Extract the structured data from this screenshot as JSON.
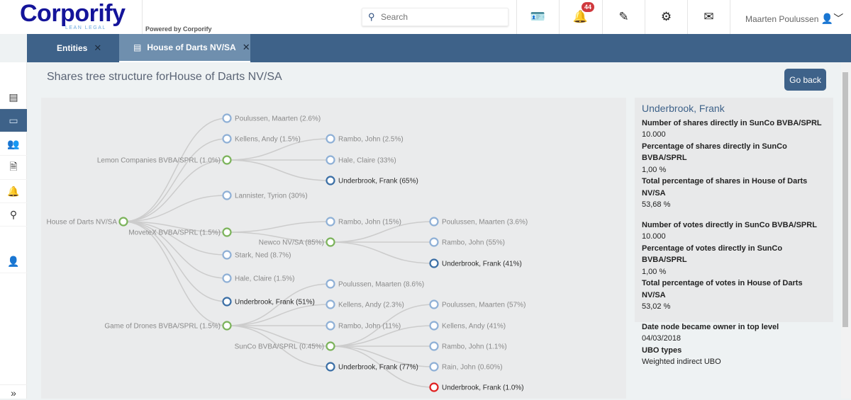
{
  "header": {
    "logo": "Corporify",
    "logo_tagline": "LEAN LEGAL",
    "powered": "Powered by Corporify",
    "search_placeholder": "Search",
    "notifications_count": "44",
    "user_name": "Maarten Poulussen"
  },
  "tabs": [
    {
      "label": "Entities",
      "close": "✕"
    },
    {
      "label": "House of Darts NV/SA",
      "close": "✕"
    }
  ],
  "sidebar": {
    "items": [
      "entities-icon",
      "id-card-icon",
      "people-icon",
      "document-icon",
      "bell-icon",
      "search-icon",
      "user-icon"
    ],
    "expand": "»"
  },
  "page": {
    "title": "Shares tree structure forHouse of Darts NV/SA",
    "go_back": "Go back"
  },
  "colors": {
    "company": "#7bb35a",
    "person": "#8fb0d6",
    "ubo": "#3a6ea5",
    "selected": "#e02020",
    "link": "#cccccc",
    "accent": "#3e6289"
  },
  "tree": {
    "label": "House of Darts NV/SA",
    "type": "company",
    "children": [
      {
        "label": "Poulussen, Maarten (2.6%)",
        "type": "person"
      },
      {
        "label": "Kellens, Andy (1.5%)",
        "type": "person"
      },
      {
        "label": "Lemon Companies BVBA/SPRL (1.0%)",
        "type": "company",
        "children": [
          {
            "label": "Rambo, John (2.5%)",
            "type": "person"
          },
          {
            "label": "Hale, Claire (33%)",
            "type": "person"
          },
          {
            "label": "Underbrook, Frank (65%)",
            "type": "ubo"
          }
        ]
      },
      {
        "label": "Lannister, Tyrion (30%)",
        "type": "person"
      },
      {
        "label": "MoveteX BVBA/SPRL (1.5%)",
        "type": "company",
        "children": [
          {
            "label": "Rambo, John (15%)",
            "type": "person"
          },
          {
            "label": "Newco NV/SA (85%)",
            "type": "company",
            "children": [
              {
                "label": "Poulussen, Maarten (3.6%)",
                "type": "person"
              },
              {
                "label": "Rambo, John (55%)",
                "type": "person"
              },
              {
                "label": "Underbrook, Frank (41%)",
                "type": "ubo"
              }
            ]
          }
        ]
      },
      {
        "label": "Stark, Ned (8.7%)",
        "type": "person"
      },
      {
        "label": "Hale, Claire (1.5%)",
        "type": "person"
      },
      {
        "label": "Underbrook, Frank (51%)",
        "type": "ubo"
      },
      {
        "label": "Game of Drones BVBA/SPRL (1.5%)",
        "type": "company",
        "children": [
          {
            "label": "Poulussen, Maarten (8.6%)",
            "type": "person"
          },
          {
            "label": "Kellens, Andy (2.3%)",
            "type": "person"
          },
          {
            "label": "Rambo, John (11%)",
            "type": "person"
          },
          {
            "label": "SunCo BVBA/SPRL (0.45%)",
            "type": "company",
            "children": [
              {
                "label": "Poulussen, Maarten (57%)",
                "type": "person"
              },
              {
                "label": "Kellens, Andy (41%)",
                "type": "person"
              },
              {
                "label": "Rambo, John (1.1%)",
                "type": "person"
              },
              {
                "label": "Rain, John (0.60%)",
                "type": "person"
              },
              {
                "label": "Underbrook, Frank (1.0%)",
                "type": "selected"
              }
            ]
          },
          {
            "label": "Underbrook, Frank (77%)",
            "type": "ubo"
          }
        ]
      }
    ]
  },
  "details": {
    "name": "Underbrook, Frank",
    "fields": [
      {
        "label": "Number of shares directly in SunCo BVBA/SPRL",
        "value": "10.000"
      },
      {
        "label": "Percentage of shares directly in SunCo BVBA/SPRL",
        "value": "1,00 %"
      },
      {
        "label": "Total percentage of shares in House of Darts NV/SA",
        "value": "53,68 %"
      },
      {
        "label": "Number of votes directly in SunCo BVBA/SPRL",
        "value": "10.000"
      },
      {
        "label": "Percentage of votes directly in SunCo BVBA/SPRL",
        "value": "1,00 %"
      },
      {
        "label": "Total percentage of votes in House of Darts NV/SA",
        "value": "53,02 %"
      },
      {
        "label": "Date node became owner in top level",
        "value": "04/03/2018"
      },
      {
        "label": "UBO types",
        "value": "Weighted indirect UBO"
      }
    ]
  }
}
